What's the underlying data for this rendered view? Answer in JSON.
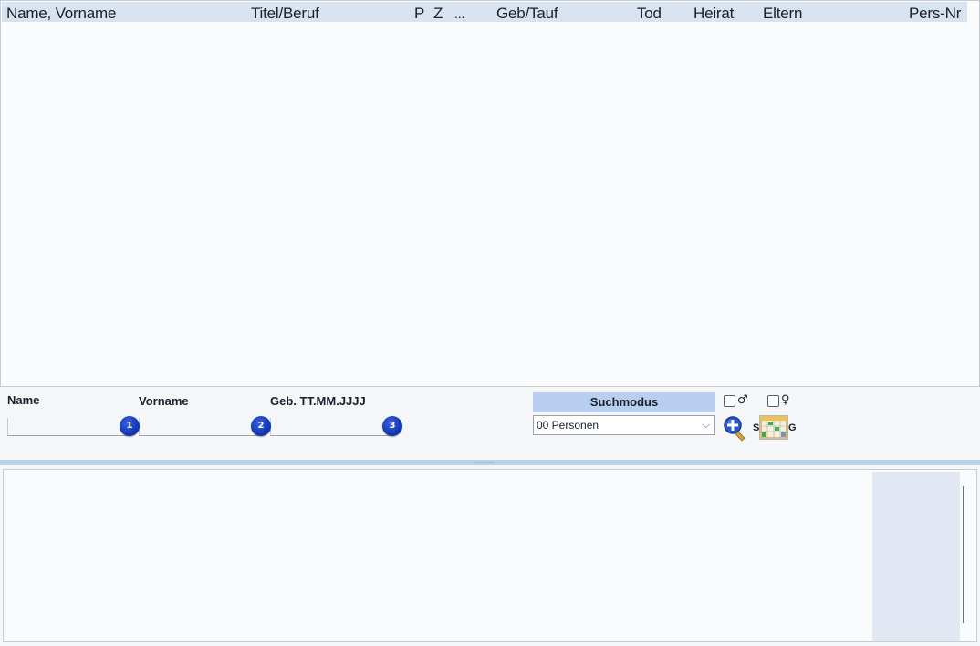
{
  "list": {
    "columns": [
      "Name, Vorname",
      "Titel/Beruf",
      "P",
      "Z",
      "...",
      "Geb/Tauf",
      "Tod",
      "Heirat",
      "Eltern",
      "Pers-Nr"
    ],
    "rows": []
  },
  "search": {
    "name_label": "Name",
    "vorname_label": "Vorname",
    "geb_label": "Geb. TT.MM.JJJJ",
    "name_value": "",
    "vorname_value": "",
    "geb_value": "",
    "badge_1": "1",
    "badge_2": "2",
    "badge_3": "3"
  },
  "suchmodus": {
    "title": "Suchmodus",
    "selected": "00 Personen",
    "male_symbol": "♂",
    "female_symbol": "♀",
    "male_checked": false,
    "female_checked": false,
    "search_button_letter": "S",
    "grid_button_letter": "G"
  },
  "colors": {
    "header_bg": "#d8e3f0",
    "suchmodus_bg": "#b8cff0",
    "accent_blue": "#1237b3",
    "splitter": "#bcd0e6"
  }
}
